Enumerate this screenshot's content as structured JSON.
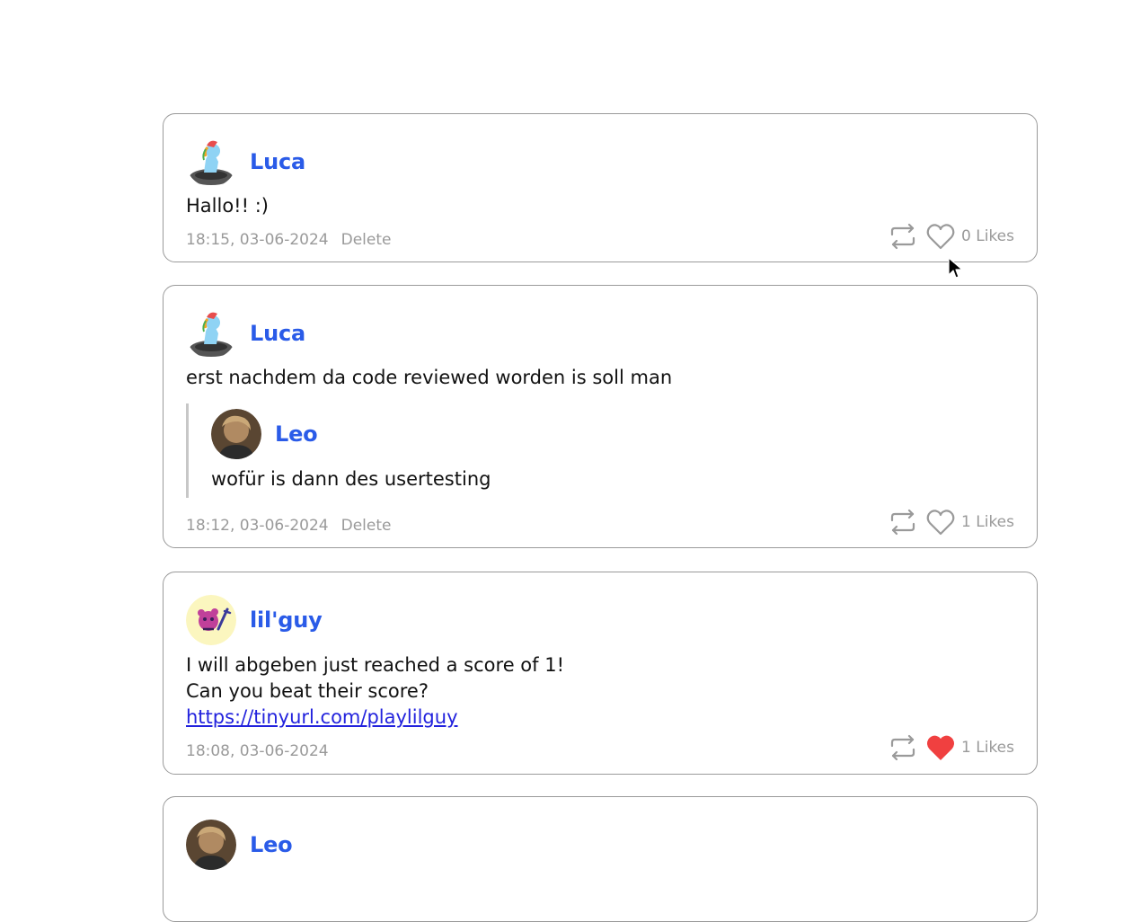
{
  "posts": [
    {
      "username": "Luca",
      "avatar": "pony-figure-avatar",
      "lines": [
        "Hallo!! :)"
      ],
      "timestamp": "18:15, 03-06-2024",
      "delete_label": "Delete",
      "likes": "0 Likes",
      "liked": false
    },
    {
      "username": "Luca",
      "avatar": "pony-figure-avatar",
      "lines": [
        "erst nachdem da code reviewed worden is soll man"
      ],
      "quote": {
        "username": "Leo",
        "avatar": "leo-photo-avatar",
        "text": "wofür is dann des usertesting"
      },
      "timestamp": "18:12, 03-06-2024",
      "delete_label": "Delete",
      "likes": "1 Likes",
      "liked": false
    },
    {
      "username": "lil'guy",
      "avatar": "lilguy-mascot-avatar",
      "lines": [
        "I will abgeben just reached a score of 1!",
        "Can you beat their score?"
      ],
      "link": "https://tinyurl.com/playlilguy",
      "timestamp": "18:08, 03-06-2024",
      "likes": "1 Likes",
      "liked": true
    },
    {
      "username": "Leo",
      "avatar": "leo-photo-avatar"
    }
  ],
  "colors": {
    "username": "#2a5be8",
    "muted": "#9a9a9a",
    "liked_heart": "#f04040",
    "link": "#2222dd"
  }
}
